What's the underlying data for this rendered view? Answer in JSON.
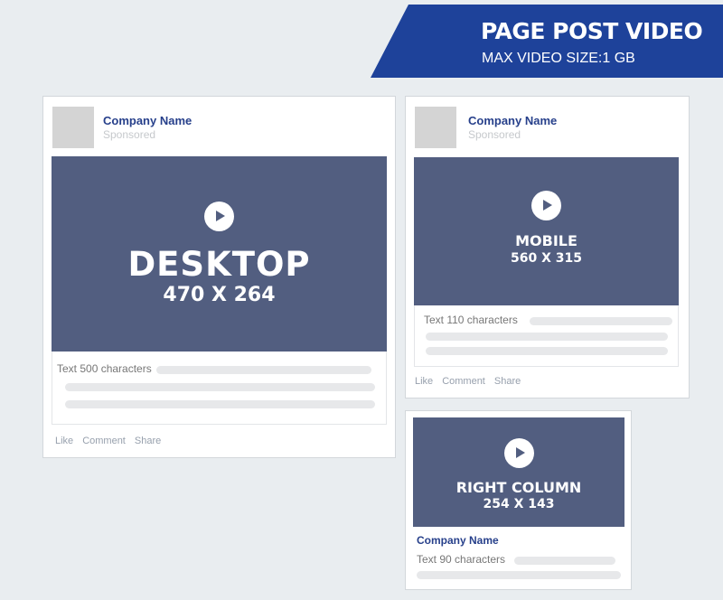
{
  "header": {
    "title": "PAGE POST VIDEO",
    "subtitle": "MAX VIDEO SIZE:1 GB",
    "color": "#1e429a"
  },
  "colors": {
    "media_bg": "#525e80",
    "company_name": "#27408b",
    "page_bg": "#e9edf0"
  },
  "desktop": {
    "company": "Company Name",
    "sponsored": "Sponsored",
    "icon": "play-icon",
    "media_title": "DESKTOP",
    "media_size": "470 X 264",
    "text_label": "Text 500 characters",
    "actions": [
      "Like",
      "Comment",
      "Share"
    ]
  },
  "mobile": {
    "company": "Company Name",
    "sponsored": "Sponsored",
    "icon": "play-icon",
    "media_title": "MOBILE",
    "media_size": "560 X 315",
    "text_label": "Text 110 characters",
    "actions": [
      "Like",
      "Comment",
      "Share"
    ]
  },
  "right_column": {
    "icon": "play-icon",
    "media_title": "RIGHT COLUMN",
    "media_size": "254 X 143",
    "company": "Company Name",
    "text_label": "Text 90 characters"
  }
}
